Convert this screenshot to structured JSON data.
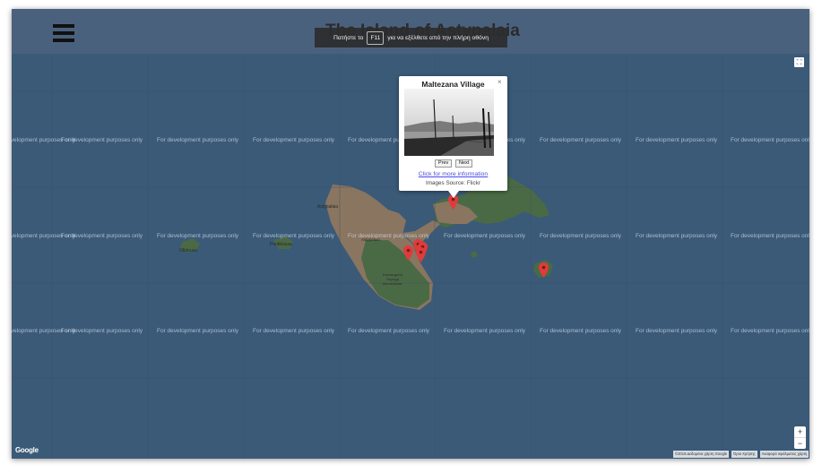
{
  "header": {
    "title": "The Island of Astypalaia",
    "menu_icon": "hamburger-menu-icon"
  },
  "fullscreen_notice": {
    "before_key": "Πατήστε το",
    "key": "F11",
    "after_key": "για να εξέλθετε από την πλήρη οθόνη"
  },
  "map": {
    "watermark": "For development purposes only",
    "labels": {
      "astypalaia": "Astypalaia",
      "ofidousa": "Ofidousa",
      "pontikousa": "Pontikousa",
      "livadi": "Κατοικημένη\nΠεριοχή\nΑστυπάλαια"
    },
    "colors": {
      "sea": "#3a5a78",
      "land": "#8a7560",
      "vegetation": "#4a6a45",
      "marker": "#e03b3b"
    }
  },
  "popup": {
    "title": "Maltezana Village",
    "prev_label": "Prev",
    "next_label": "Next",
    "link_text": "Click for more information",
    "source_text": "Images Source: Flickr",
    "close_icon": "close-icon"
  },
  "controls": {
    "fullscreen_icon": "fullscreen-icon",
    "zoom_in": "+",
    "zoom_out": "−"
  },
  "attribution": {
    "logo": "Google",
    "data": "©2019 Δεδομένα χάρτη Google",
    "terms": "Όροι Χρήσης",
    "report": "Αναφορά σφάλματος χάρτη"
  }
}
